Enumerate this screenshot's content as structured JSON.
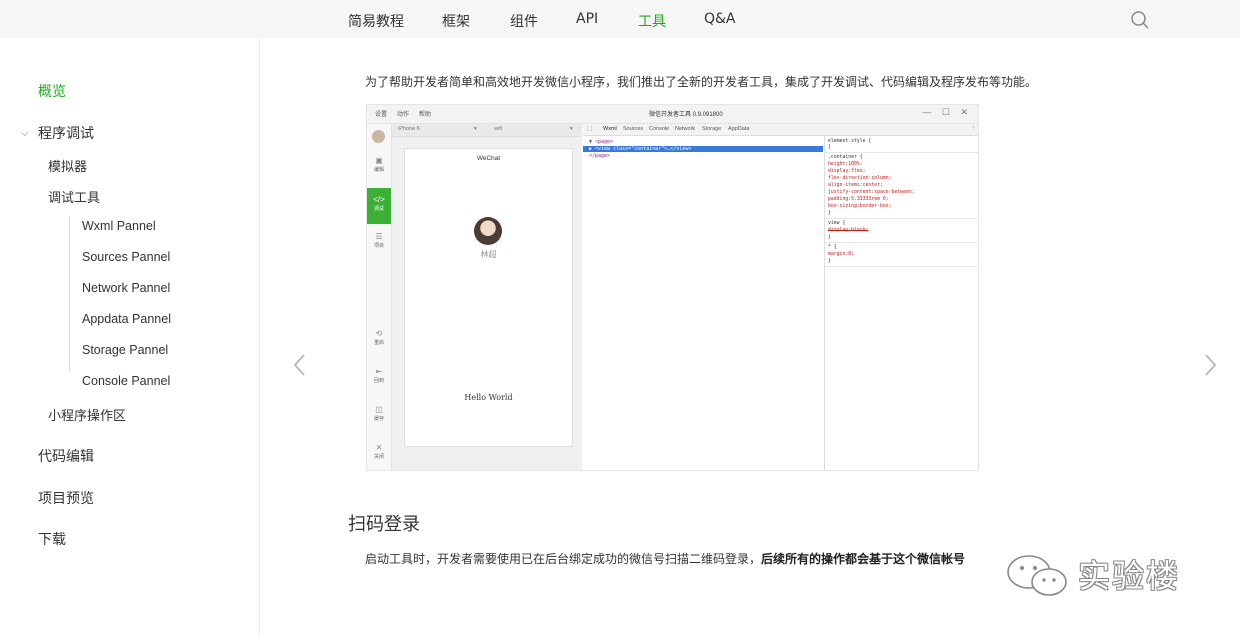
{
  "nav": {
    "items": [
      "简易教程",
      "框架",
      "组件",
      "API",
      "工具",
      "Q&A"
    ],
    "active_index": 4,
    "accent_color": "#1aad19"
  },
  "sidebar": {
    "items": [
      {
        "label": "概览",
        "level": 1,
        "active": true
      },
      {
        "label": "程序调试",
        "level": 1,
        "expanded": true
      },
      {
        "label": "模拟器",
        "level": 2
      },
      {
        "label": "调试工具",
        "level": 2
      },
      {
        "label": "Wxml Pannel",
        "level": 3
      },
      {
        "label": "Sources Pannel",
        "level": 3
      },
      {
        "label": "Network Pannel",
        "level": 3
      },
      {
        "label": "Appdata Pannel",
        "level": 3
      },
      {
        "label": "Storage Pannel",
        "level": 3
      },
      {
        "label": "Console Pannel",
        "level": 3
      },
      {
        "label": "小程序操作区",
        "level": 2
      },
      {
        "label": "代码编辑",
        "level": 1
      },
      {
        "label": "项目预览",
        "level": 1
      },
      {
        "label": "下载",
        "level": 1
      }
    ]
  },
  "content": {
    "intro": "为了帮助开发者简单和高效地开发微信小程序，我们推出了全新的开发者工具，集成了开发调试、代码编辑及程序发布等功能。",
    "heading": "扫码登录",
    "para_normal": "启动工具时，开发者需要使用已在后台绑定成功的微信号扫描二维码登录，",
    "para_bold": "后续所有的操作都会基于这个微信帐号"
  },
  "ide": {
    "menu": [
      "设置",
      "动作",
      "帮助"
    ],
    "title": "微信开发者工具 0.9.091800",
    "win_buttons": "— ☐ ✕",
    "tools": [
      "编辑",
      "调试",
      "项目",
      "重启",
      "回到",
      "缓存",
      "关闭"
    ],
    "device": "iPhone 6",
    "network": "wifi",
    "phone_title": "WeChat",
    "nickname": "林超",
    "hello": "Hello World",
    "dev_tabs": [
      "Wxml",
      "Sources",
      "Console",
      "Network",
      "Storage",
      "AppData"
    ],
    "dom_lines": [
      "▼ <page>",
      "  ▶ <view class=\"container\">…</view>",
      "</page>"
    ],
    "style_lines": [
      "element.style {",
      "}",
      ".container {",
      "  height:100%;",
      "  display:flex;",
      "  flex-direction:column;",
      "  align-items:center;",
      "  justify-content:space-between;",
      "  padding:5.33333rem 0;",
      "  box-sizing:border-box;",
      "}",
      "view {",
      "  display:block;",
      "}",
      "* {",
      "  margin:0;",
      "}"
    ]
  },
  "watermark": {
    "text": "实验楼"
  }
}
